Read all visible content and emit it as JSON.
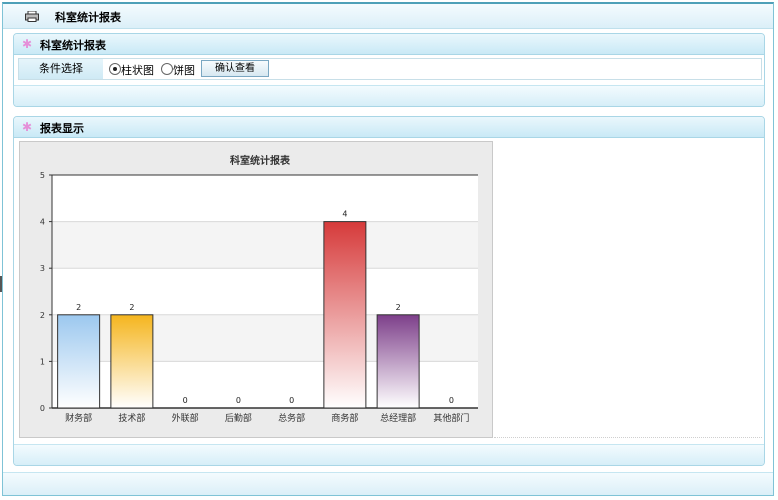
{
  "page": {
    "title": "科室统计报表"
  },
  "query_panel": {
    "title": "科室统计报表",
    "condition_label": "条件选择",
    "options": [
      {
        "label": "柱状图",
        "selected": true
      },
      {
        "label": "饼图",
        "selected": false
      }
    ],
    "confirm_label": "确认查看"
  },
  "report_panel": {
    "title": "报表显示"
  },
  "chart_data": {
    "type": "bar",
    "title": "科室统计报表",
    "categories": [
      "财务部",
      "技术部",
      "外联部",
      "后勤部",
      "总务部",
      "商务部",
      "总经理部",
      "其他部门"
    ],
    "values": [
      2,
      2,
      0,
      0,
      0,
      4,
      2,
      0
    ],
    "ylim": [
      0,
      5
    ],
    "yticks": [
      "0",
      "1",
      "2",
      "3",
      "4",
      "5"
    ],
    "data_labels": [
      "2",
      "2",
      "0",
      "0",
      "0",
      "4",
      "2",
      "0"
    ],
    "xlabel": "",
    "ylabel": "",
    "grid": true,
    "colors": [
      "#9cc8ef",
      "#f5b51e",
      "#cccccc",
      "#cccccc",
      "#cccccc",
      "#d63a3a",
      "#7d3f8a",
      "#cccccc"
    ]
  }
}
